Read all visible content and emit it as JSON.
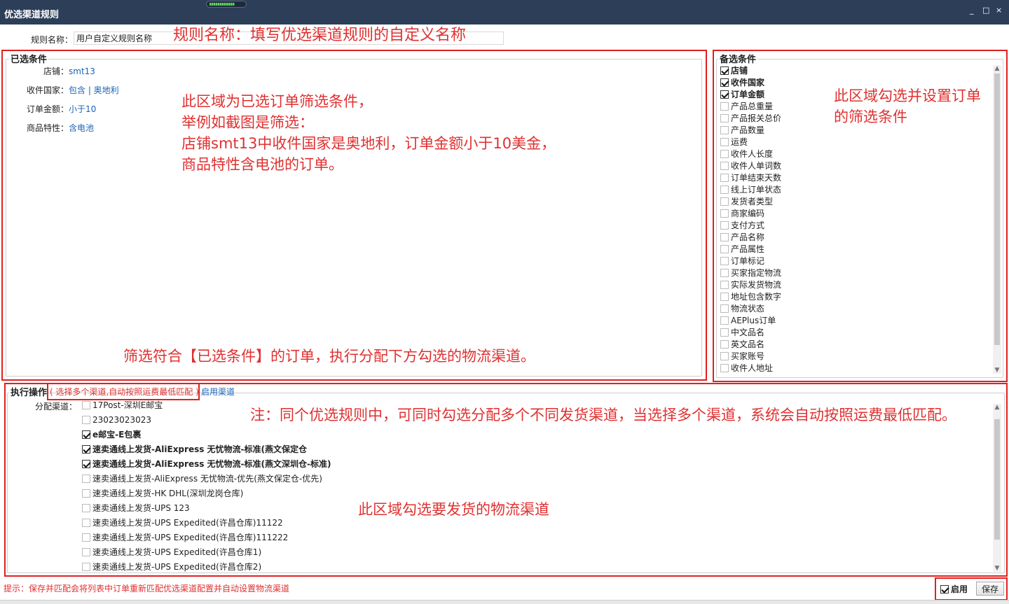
{
  "window": {
    "title": "优选渠道规则",
    "controls": [
      "_",
      "□",
      "×"
    ]
  },
  "rule_name": {
    "label": "规则名称：",
    "value": "用户自定义规则名称"
  },
  "annotations": {
    "rule_name": "规则名称：填写优选渠道规则的自定义名称",
    "selected_lines": [
      "此区域为已选订单筛选条件，",
      "举例如截图是筛选：",
      "店铺smt13中收件国家是奥地利，订单金额小于10美金，",
      "商品特性含电池的订单。"
    ],
    "filter_note": "筛选符合【已选条件】的订单，执行分配下方勾选的物流渠道。",
    "optional_lines": [
      "此区域勾选并设置订单",
      "的筛选条件"
    ],
    "multi_note": "注：同个优选规则中，可同时勾选分配多个不同发货渠道，当选择多个渠道，系统会自动按照运费最低匹配。",
    "channel_note": "此区域勾选要发货的物流渠道"
  },
  "selected_conditions": {
    "title": "已选条件",
    "rows": [
      {
        "label": "店铺：",
        "value": "smt13"
      },
      {
        "label": "收件国家：",
        "value": "包含 | 奥地利"
      },
      {
        "label": "订单金额：",
        "value": "小于10"
      },
      {
        "label": "商品特性：",
        "value": "含电池"
      }
    ]
  },
  "optional_conditions": {
    "title": "备选条件",
    "items": [
      {
        "label": "店铺",
        "checked": true
      },
      {
        "label": "收件国家",
        "checked": true
      },
      {
        "label": "订单金额",
        "checked": true
      },
      {
        "label": "产品总重量",
        "checked": false
      },
      {
        "label": "产品报关总价",
        "checked": false
      },
      {
        "label": "产品数量",
        "checked": false
      },
      {
        "label": "运费",
        "checked": false
      },
      {
        "label": "收件人长度",
        "checked": false
      },
      {
        "label": "收件人单词数",
        "checked": false
      },
      {
        "label": "订单结束天数",
        "checked": false
      },
      {
        "label": "线上订单状态",
        "checked": false
      },
      {
        "label": "发货者类型",
        "checked": false
      },
      {
        "label": "商家编码",
        "checked": false
      },
      {
        "label": "支付方式",
        "checked": false
      },
      {
        "label": "产品名称",
        "checked": false
      },
      {
        "label": "产品属性",
        "checked": false
      },
      {
        "label": "订单标记",
        "checked": false
      },
      {
        "label": "买家指定物流",
        "checked": false
      },
      {
        "label": "实际发货物流",
        "checked": false
      },
      {
        "label": "地址包含数字",
        "checked": false
      },
      {
        "label": "物流状态",
        "checked": false
      },
      {
        "label": "AEPlus订单",
        "checked": false
      },
      {
        "label": "中文品名",
        "checked": false
      },
      {
        "label": "英文品名",
        "checked": false
      },
      {
        "label": "买家账号",
        "checked": false
      },
      {
        "label": "收件人地址",
        "checked": false
      }
    ]
  },
  "execute": {
    "title": "执行操作",
    "note": "( 选择多个渠道,自动按照运费最低匹配 )",
    "enable_link": "启用渠道",
    "assign_label": "分配渠道：",
    "channels": [
      {
        "label": "17Post-深圳E邮宝",
        "checked": false
      },
      {
        "label": "23023023023",
        "checked": false
      },
      {
        "label": "e邮宝-E包裹",
        "checked": true
      },
      {
        "label": "速卖通线上发货-AliExpress 无忧物流-标准(燕文保定仓",
        "checked": true
      },
      {
        "label": "速卖通线上发货-AliExpress 无忧物流-标准(燕文深圳仓-标准)",
        "checked": true
      },
      {
        "label": "速卖通线上发货-AliExpress 无忧物流-优先(燕文保定仓-优先)",
        "checked": false
      },
      {
        "label": "速卖通线上发货-HK DHL(深圳龙岗仓库)",
        "checked": false
      },
      {
        "label": "速卖通线上发货-UPS 123",
        "checked": false
      },
      {
        "label": "速卖通线上发货-UPS Expedited(许昌仓库)11122",
        "checked": false
      },
      {
        "label": "速卖通线上发货-UPS Expedited(许昌仓库)111222",
        "checked": false
      },
      {
        "label": "速卖通线上发货-UPS Expedited(许昌仓库1)",
        "checked": false
      },
      {
        "label": "速卖通线上发货-UPS Expedited(许昌仓库2)",
        "checked": false
      }
    ]
  },
  "footer": {
    "hint": "提示：保存并匹配会将列表中订单重新匹配优选渠道配置并自动设置物流渠道",
    "enable_label": "启用",
    "enable_checked": true,
    "save_label": "保存"
  },
  "colors": {
    "titlebar": "#2c3e58",
    "annotation_red": "#e03030",
    "link_blue": "#1a63b8"
  }
}
